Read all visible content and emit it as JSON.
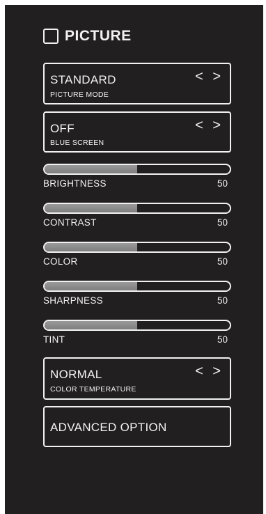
{
  "header": {
    "title": "PICTURE",
    "icon": "checkbox-icon"
  },
  "picture_mode": {
    "value": "STANDARD",
    "label": "PICTURE MODE",
    "arrows": "< >"
  },
  "blue_screen": {
    "value": "OFF",
    "label": "BLUE SCREEN",
    "arrows": "< >"
  },
  "sliders": [
    {
      "label": "BRIGHTNESS",
      "value": "50",
      "level": 0.5
    },
    {
      "label": "CONTRAST",
      "value": "50",
      "level": 0.5
    },
    {
      "label": "COLOR",
      "value": "50",
      "level": 0.5
    },
    {
      "label": "SHARPNESS",
      "value": "50",
      "level": 0.5
    },
    {
      "label": "TINT",
      "value": "50",
      "level": 0.5
    }
  ],
  "color_temperature": {
    "value": "NORMAL",
    "label": "COLOR TEMPERATURE",
    "arrows": "< >"
  },
  "advanced": {
    "label": "ADVANCED OPTION"
  },
  "colors": {
    "background": "#221f20",
    "foreground": "#f2f2f2",
    "slider_fill": "#8c8c8c"
  }
}
